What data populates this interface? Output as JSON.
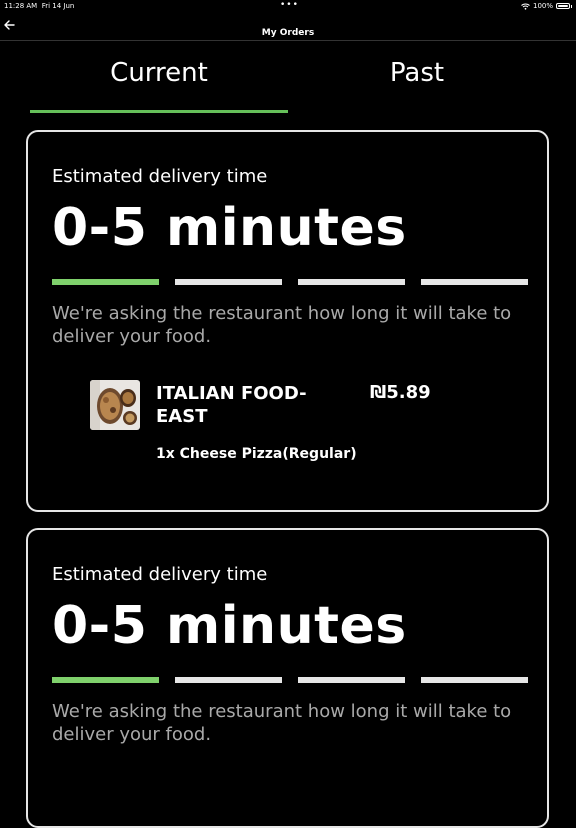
{
  "status_bar": {
    "time": "11:28 AM",
    "date": "Fri 14 Jun",
    "center_dots": "•••",
    "battery": "100%",
    "wifi_icon": "wifi-icon",
    "battery_icon": "battery-icon"
  },
  "nav": {
    "title": "My Orders",
    "back_icon": "arrow-left-icon"
  },
  "tabs": [
    {
      "label": "Current",
      "selected": true
    },
    {
      "label": "Past",
      "selected": false
    }
  ],
  "accent_color": "#66c05a",
  "orders": [
    {
      "estimate_label": "Estimated delivery time",
      "estimate_value": "0-5 minutes",
      "progress": {
        "total_steps": 4,
        "completed_steps": 1
      },
      "status_message": "We're asking the restaurant how long it will take to deliver your food.",
      "restaurant": {
        "name": "ITALIAN FOOD-EAST",
        "price": "₪5.89",
        "item": "1x Cheese Pizza(Regular)"
      }
    },
    {
      "estimate_label": "Estimated delivery time",
      "estimate_value": "0-5 minutes",
      "progress": {
        "total_steps": 4,
        "completed_steps": 1
      },
      "status_message": "We're asking the restaurant how long it will take to deliver your food."
    }
  ]
}
